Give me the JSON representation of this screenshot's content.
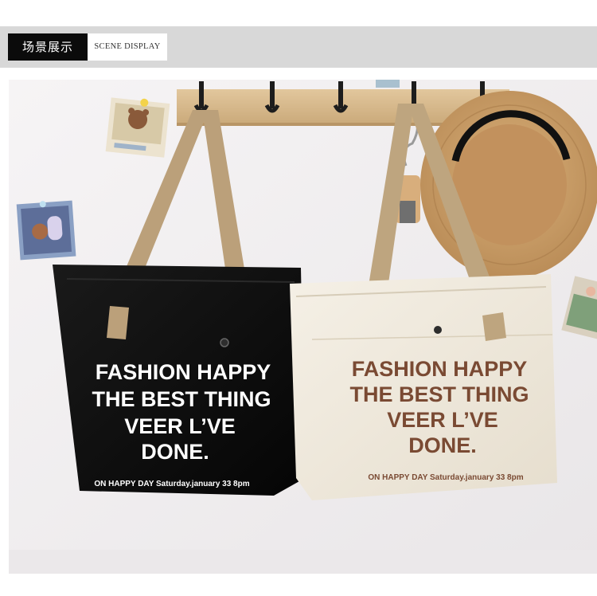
{
  "header": {
    "tag_primary": "场景展示",
    "tag_secondary": "SCENE DISPLAY"
  },
  "scene": {
    "subject": "Two canvas tote bags hanging on a wall hook rack next to a straw hat",
    "bag_black": {
      "line1": "FASHION HAPPY",
      "line2": "THE BEST THING",
      "line3": "VEER L’VE",
      "line4": "DONE.",
      "footer": "ON HAPPY DAY Saturday.january 33   8pm",
      "body_color": "#0c0c0c",
      "print_color": "#ffffff"
    },
    "bag_cream": {
      "line1": "FASHION HAPPY",
      "line2": "THE BEST THING",
      "line3": "VEER L’VE",
      "line4": "DONE.",
      "footer": "ON HAPPY DAY Saturday.january 33   8pm",
      "body_color": "#efe9dc",
      "print_color": "#7a4a33"
    },
    "colors": {
      "wall": "#f1eff0",
      "rack": "#d6b98f",
      "strap": "#bda27c",
      "hat": "#c99f6b"
    }
  }
}
